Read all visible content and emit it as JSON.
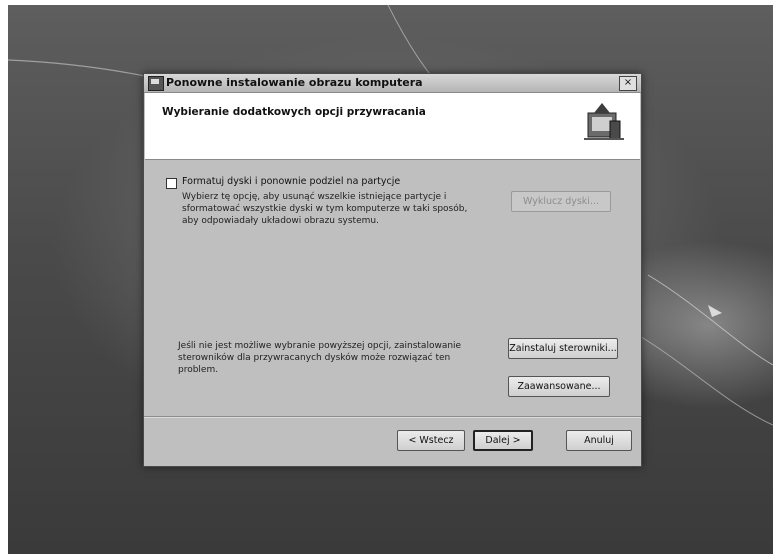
{
  "window": {
    "title": "Ponowne instalowanie obrazu komputera",
    "close_glyph": "×"
  },
  "header": {
    "heading": "Wybieranie dodatkowych opcji przywracania",
    "icon": "restore-wizard-icon"
  },
  "format_option": {
    "checkbox_label": "Formatuj dyski i ponownie podziel na partycje",
    "checked": false,
    "description_lines": [
      "Wybierz tę opcję, aby usunąć wszelkie istniejące partycje i",
      "sformatować wszystkie dyski w tym komputerze w taki sposób,",
      "aby odpowiadały układowi obrazu systemu."
    ],
    "exclude_button": "Wyklucz dyski..."
  },
  "drivers": {
    "note_lines": [
      "Jeśli nie jest możliwe wybranie powyższej opcji, zainstalowanie",
      "sterowników dla przywracanych dysków może rozwiązać ten",
      "problem."
    ],
    "install_button": "Zainstaluj sterowniki...",
    "advanced_button": "Zaawansowane..."
  },
  "footer": {
    "back_button": "< Wstecz",
    "next_button": "Dalej >",
    "cancel_button": "Anuluj"
  }
}
